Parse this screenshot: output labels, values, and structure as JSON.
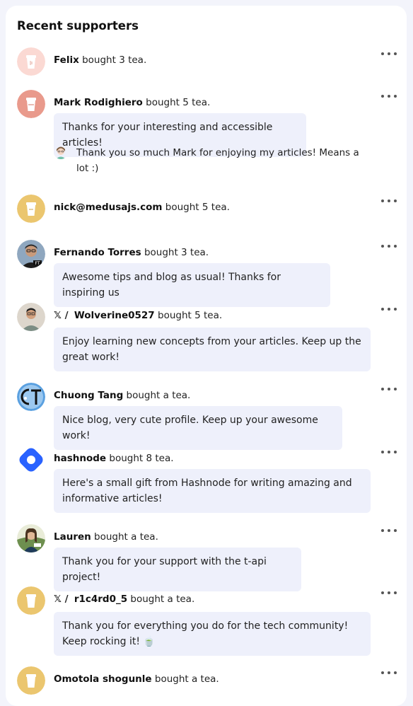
{
  "panel": {
    "title": "Recent supporters"
  },
  "supporters": [
    {
      "name": "Felix",
      "action": "bought 3 tea.",
      "x_prefix": "",
      "message": "",
      "avatar": "tea-cup-icon-pink"
    },
    {
      "name": "Mark Rodighiero",
      "action": "bought 5 tea.",
      "x_prefix": "",
      "message": "Thanks for your interesting and accessible articles!",
      "avatar": "tea-cup-icon-rose",
      "reply": "Thank you so much Mark for enjoying my articles! Means a lot :)"
    },
    {
      "name": "nick@medusajs.com",
      "action": "bought 5 tea.",
      "x_prefix": "",
      "message": "",
      "avatar": "tea-cup-icon-gold"
    },
    {
      "name": "Fernando Torres",
      "action": "bought 3 tea.",
      "x_prefix": "",
      "message": "Awesome tips and blog as usual! Thanks for inspiring us",
      "avatar": "user-photo"
    },
    {
      "name": "Wolverine0527",
      "action": "bought 5 tea.",
      "x_prefix": "𝕏 /",
      "message": "Enjoy learning new concepts from your articles. Keep up the great work!",
      "avatar": "user-photo"
    },
    {
      "name": "Chuong Tang",
      "action": "bought a tea.",
      "x_prefix": "",
      "message": "Nice blog, very cute profile. Keep up your awesome work!",
      "avatar": "ct-logo"
    },
    {
      "name": "hashnode",
      "action": "bought 8 tea.",
      "x_prefix": "",
      "message": "Here's a small gift from Hashnode for writing amazing and informative articles!",
      "avatar": "hashnode-logo"
    },
    {
      "name": "Lauren",
      "action": "bought a tea.",
      "x_prefix": "",
      "message": "Thank you for your support with the t-api project!",
      "avatar": "user-photo"
    },
    {
      "name": "r1c4rd0_5",
      "action": "bought a tea.",
      "x_prefix": "𝕏 /",
      "message": "Thank you for everything you do for the tech community! Keep rocking it! 🍵",
      "avatar": "tea-cup-icon-gold"
    },
    {
      "name": "Omotola shogunle",
      "action": "bought a tea.",
      "x_prefix": "",
      "message": "",
      "avatar": "tea-cup-icon-gold"
    }
  ],
  "colors": {
    "bubble": "#eef0fb",
    "background": "#f3f4fb",
    "hashnode": "#2962ff"
  }
}
